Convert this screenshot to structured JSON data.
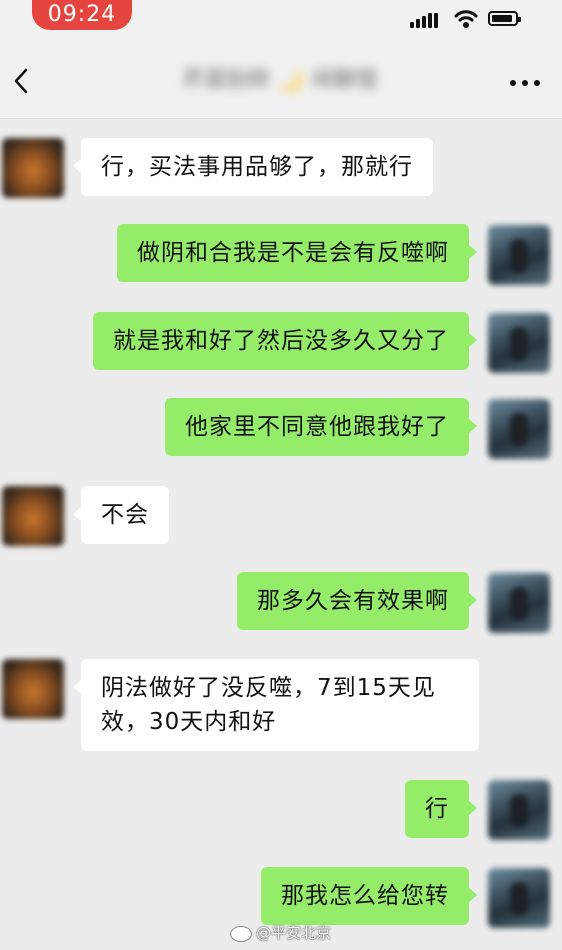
{
  "status_bar": {
    "time": "09:24"
  },
  "nav": {
    "title": "芹菜别样 🌙 闲聊馆"
  },
  "messages": [
    {
      "side": "left",
      "text": "行，买法事用品够了，那就行"
    },
    {
      "side": "right",
      "text": "做阴和合我是不是会有反噬啊"
    },
    {
      "side": "right",
      "text": "就是我和好了然后没多久又分了"
    },
    {
      "side": "right",
      "text": "他家里不同意他跟我好了"
    },
    {
      "side": "left",
      "text": "不会"
    },
    {
      "side": "right",
      "text": "那多久会有效果啊"
    },
    {
      "side": "left",
      "text": "阴法做好了没反噬，7到15天见效，30天内和好"
    },
    {
      "side": "right",
      "text": "行"
    },
    {
      "side": "right",
      "text": "那我怎么给您转"
    }
  ],
  "watermark": {
    "text": "@平安北京"
  },
  "colors": {
    "time_pill": "#e5443f",
    "sent_bubble": "#95ec69",
    "received_bubble": "#ffffff",
    "background": "#ececec"
  }
}
